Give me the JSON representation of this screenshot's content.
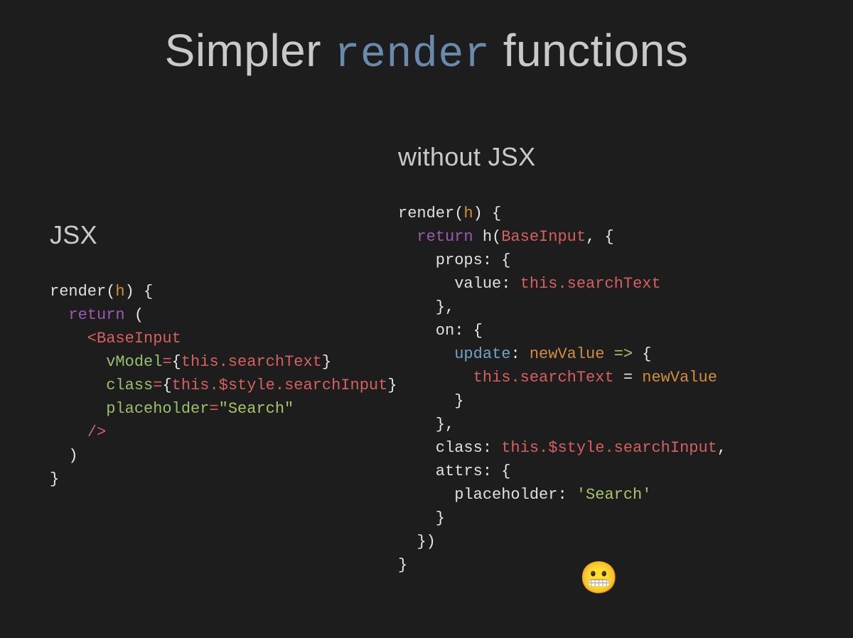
{
  "title": {
    "pre": "Simpler ",
    "accent": "render",
    "post": " functions"
  },
  "left": {
    "heading": "JSX",
    "code": {
      "l1_render": "render",
      "l1_open": "(",
      "l1_h": "h",
      "l1_close": ") {",
      "l2_return": "return",
      "l2_paren": " (",
      "l3_lt": "    <",
      "l3_tag": "BaseInput",
      "l4_attr": "      vModel",
      "l4_eq": "=",
      "l4_br_o": "{",
      "l4_this": "this",
      "l4_prop": ".searchText",
      "l4_br_c": "}",
      "l5_attr": "      class",
      "l5_eq": "=",
      "l5_br_o": "{",
      "l5_this": "this",
      "l5_prop": ".$style.searchInput",
      "l5_br_c": "}",
      "l6_attr": "      placeholder",
      "l6_eq": "=",
      "l6_str": "\"Search\"",
      "l7_close": "    />",
      "l8": "  )",
      "l9": "}"
    }
  },
  "right": {
    "heading": "without JSX",
    "code": {
      "l1_render": "render",
      "l1_open": "(",
      "l1_h": "h",
      "l1_close": ") {",
      "l2_return": "return",
      "l2_sp": " ",
      "l2_hcall": "h",
      "l2_paren": "(",
      "l2_comp": "BaseInput",
      "l2_comma": ", {",
      "l3_props": "    props",
      "l3_colon": ": {",
      "l4_value": "      value",
      "l4_colon": ": ",
      "l4_this": "this",
      "l4_prop": ".searchText",
      "l5_close": "    },",
      "l6_on": "    on",
      "l6_colon": ": {",
      "l7_update": "      update",
      "l7_colon": ": ",
      "l7_nv": "newValue",
      "l7_arrow": " => ",
      "l7_brace": "{",
      "l8_this": "        this",
      "l8_prop": ".searchText",
      "l8_eq": " = ",
      "l8_nv": "newValue",
      "l9_close": "      }",
      "l10_close": "    },",
      "l11_class": "    class",
      "l11_colon": ": ",
      "l11_this": "this",
      "l11_prop": ".$style.searchInput",
      "l11_comma": ",",
      "l12_attrs": "    attrs",
      "l12_colon": ": {",
      "l13_ph": "      placeholder",
      "l13_colon": ": ",
      "l13_str": "'Search'",
      "l14_close": "    }",
      "l15_close": "  })",
      "l16": "}"
    }
  },
  "emoji": "😬"
}
